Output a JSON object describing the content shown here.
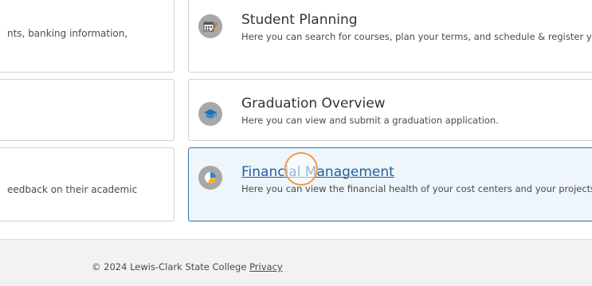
{
  "left_cards": [
    {
      "description": "nts, banking information,"
    },
    {
      "description": ""
    },
    {
      "description": "eedback on their academic"
    }
  ],
  "apps": [
    {
      "title": "Student Planning",
      "description": "Here you can search for courses, plan your terms, and schedule & register you",
      "icon": "calendar-pencil-icon"
    },
    {
      "title": "Graduation Overview",
      "description": "Here you can view and submit a graduation application.",
      "icon": "graduation-cap-icon"
    },
    {
      "title": "Financial Management",
      "description": "Here you can view the financial health of your cost centers and your projects.",
      "icon": "pie-chart-icon"
    }
  ],
  "footer": {
    "copyright": "© 2024 Lewis-Clark State College",
    "privacy_label": "Privacy"
  },
  "colors": {
    "link": "#1f5f9e",
    "active_border": "#2f6fa8",
    "cursor_ring": "#f39b45"
  }
}
